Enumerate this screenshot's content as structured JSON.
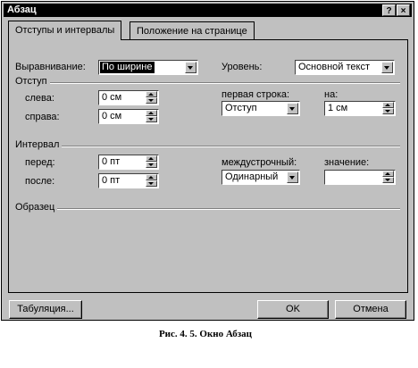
{
  "window": {
    "title": "Абзац",
    "help_button": "?",
    "close_button": "×"
  },
  "tabs": [
    {
      "label": "Отступы и интервалы",
      "active": true
    },
    {
      "label": "Положение на странице",
      "active": false
    }
  ],
  "alignment": {
    "label": "Выравнивание:",
    "value": "По ширине"
  },
  "level": {
    "label": "Уровень:",
    "value": "Основной текст"
  },
  "indent": {
    "section": "Отступ",
    "left_label": "слева:",
    "left_value": "0 см",
    "right_label": "справа:",
    "right_value": "0 см",
    "first_line_label": "первая строка:",
    "first_line_value": "Отступ",
    "by_label": "на:",
    "by_value": "1 см"
  },
  "spacing": {
    "section": "Интервал",
    "before_label": "перед:",
    "before_value": "0 пт",
    "after_label": "после:",
    "after_value": "0 пт",
    "line_spacing_label": "междустрочный:",
    "line_spacing_value": "Одинарный",
    "at_label": "значение:",
    "at_value": ""
  },
  "preview": {
    "section": "Образец"
  },
  "buttons": {
    "tabs": "Табуляция...",
    "ok": "OK",
    "cancel": "Отмена"
  },
  "caption": "Рис. 4. 5. Окно Абзац"
}
